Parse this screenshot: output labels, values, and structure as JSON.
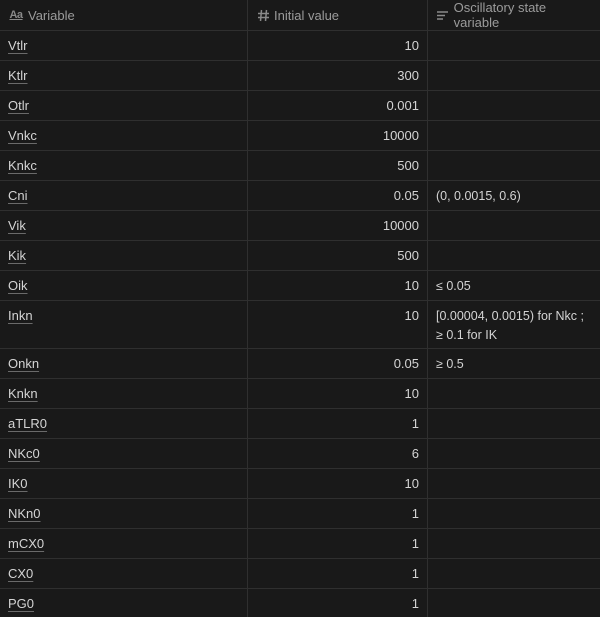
{
  "columns": {
    "variable": {
      "label": "Variable",
      "icon": "text-type-icon"
    },
    "initial_value": {
      "label": "Initial value",
      "icon": "number-hash-icon"
    },
    "oscillatory": {
      "label": "Oscillatory state variable",
      "icon": "text-lines-icon"
    }
  },
  "rows": [
    {
      "variable": "Vtlr",
      "initial_value": "10",
      "oscillatory": ""
    },
    {
      "variable": "Ktlr",
      "initial_value": "300",
      "oscillatory": ""
    },
    {
      "variable": "Otlr",
      "initial_value": "0.001",
      "oscillatory": ""
    },
    {
      "variable": "Vnkc",
      "initial_value": "10000",
      "oscillatory": ""
    },
    {
      "variable": "Knkc",
      "initial_value": "500",
      "oscillatory": ""
    },
    {
      "variable": "Cni",
      "initial_value": "0.05",
      "oscillatory": " (0, 0.0015, 0.6)"
    },
    {
      "variable": "Vik",
      "initial_value": "10000",
      "oscillatory": ""
    },
    {
      "variable": "Kik",
      "initial_value": "500",
      "oscillatory": ""
    },
    {
      "variable": "Oik",
      "initial_value": "10",
      "oscillatory": "≤ 0.05"
    },
    {
      "variable": "Inkn",
      "initial_value": "10",
      "oscillatory": " [0.00004, 0.0015) for Nkc ; ≥ 0.1 for IK"
    },
    {
      "variable": "Onkn",
      "initial_value": "0.05",
      "oscillatory": "≥ 0.5"
    },
    {
      "variable": "Knkn",
      "initial_value": "10",
      "oscillatory": ""
    },
    {
      "variable": "aTLR0",
      "initial_value": "1",
      "oscillatory": ""
    },
    {
      "variable": "NKc0",
      "initial_value": "6",
      "oscillatory": ""
    },
    {
      "variable": "IK0",
      "initial_value": "10",
      "oscillatory": ""
    },
    {
      "variable": "NKn0",
      "initial_value": "1",
      "oscillatory": ""
    },
    {
      "variable": "mCX0",
      "initial_value": "1",
      "oscillatory": ""
    },
    {
      "variable": "CX0",
      "initial_value": "1",
      "oscillatory": ""
    },
    {
      "variable": "PG0",
      "initial_value": "1",
      "oscillatory": ""
    }
  ]
}
